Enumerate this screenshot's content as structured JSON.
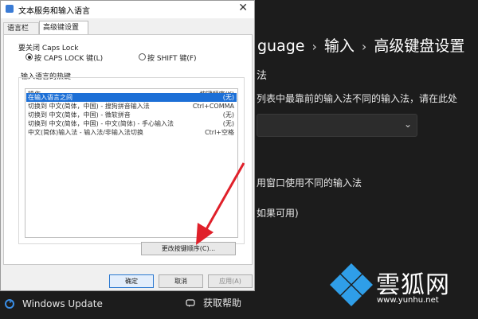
{
  "background": {
    "breadcrumb": [
      "guage",
      "输入",
      "高级键盘设置"
    ],
    "lines": {
      "section": "法",
      "desc": "列表中最靠前的输入法不同的输入法，请在此处",
      "per_window": "用窗口使用不同的输入法",
      "if_available": "如果可用)"
    },
    "taskbar": {
      "windows_update": "Windows Update",
      "help": "获取帮助"
    }
  },
  "dialog": {
    "title": "文本服务和输入语言",
    "tabs": [
      "语言栏",
      "高级键设置"
    ],
    "caps_section": "要关闭 Caps Lock",
    "caps_options": [
      "按 CAPS LOCK 键(L)",
      "按 SHIFT 键(F)"
    ],
    "hotkeys_section": "输入语言的热键",
    "columns": {
      "action": "操作",
      "keys": "按键顺序(K)"
    },
    "rows": [
      {
        "action": "在输入语言之间",
        "keys": "(无)"
      },
      {
        "action": "切换到 中文(简体，中国) - 搜狗拼音输入法",
        "keys": "Ctrl+COMMA"
      },
      {
        "action": "切换到 中文(简体，中国) - 微软拼音",
        "keys": "(无)"
      },
      {
        "action": "切换到 中文(简体，中国) - 中文(简体) - 手心输入法",
        "keys": "(无)"
      },
      {
        "action": "中文(简体)输入法 - 输入法/非输入法切换",
        "keys": "Ctrl+空格"
      }
    ],
    "change_key_button": "更改按键顺序(C)...",
    "ok": "确定",
    "cancel": "取消",
    "apply": "应用(A)"
  },
  "watermark": {
    "name": "雲狐网",
    "url": "www.yunhu.net"
  },
  "colors": {
    "selection": "#1c6fd6",
    "arrow": "#e0202a",
    "background": "#1c1c1c"
  }
}
